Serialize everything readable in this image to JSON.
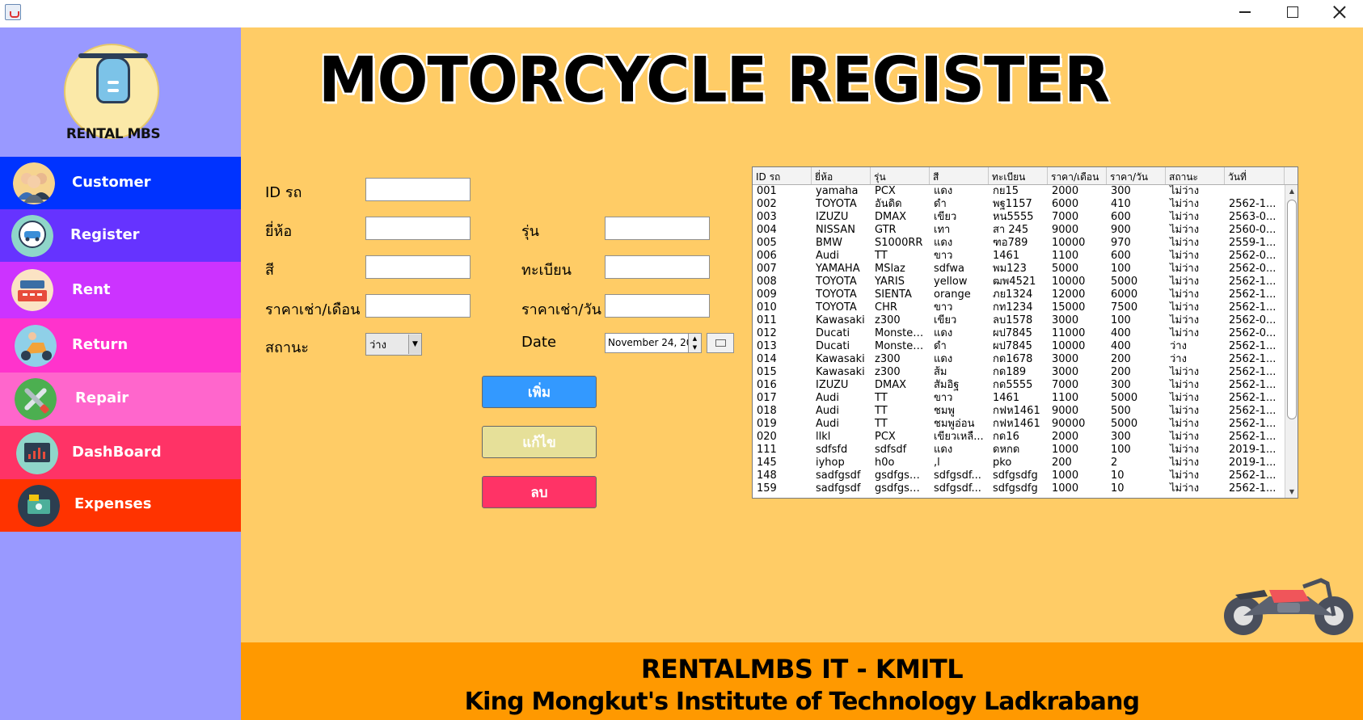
{
  "app": {
    "logo_text": "RENTAL MBS",
    "page_title": "MOTORCYCLE REGISTER"
  },
  "sidebar": {
    "items": [
      {
        "label": "Customer"
      },
      {
        "label": "Register"
      },
      {
        "label": "Rent"
      },
      {
        "label": "Return"
      },
      {
        "label": "Repair"
      },
      {
        "label": "DashBoard"
      },
      {
        "label": "Expenses"
      }
    ]
  },
  "form": {
    "id_label": "ID รถ",
    "brand_label": "ยี่ห้อ",
    "model_label": "รุ่น",
    "color_label": "สี",
    "plate_label": "ทะเบียน",
    "monthly_label": "ราคาเช่า/เดือน",
    "daily_label": "ราคาเช่า/วัน",
    "status_label": "สถานะ",
    "status_value": "ว่าง",
    "date_label": "Date",
    "date_value": "November 24, 20"
  },
  "buttons": {
    "add": "เพิ่ม",
    "edit": "แก้ไข",
    "delete": "ลบ"
  },
  "table": {
    "headers": [
      "ID รถ",
      "ยี่ห้อ",
      "รุ่น",
      "สี",
      "ทะเบียน",
      "ราคา/เดือน",
      "ราคา/วัน",
      "สถานะ",
      "วันที่"
    ],
    "rows": [
      [
        "001",
        "yamaha",
        "PCX",
        "แดง",
        "กย15",
        "2000",
        "300",
        "ไม่ว่าง",
        ""
      ],
      [
        "002",
        "TOYOTA",
        "อันดิด",
        "ดำ",
        "พฐ1157",
        "6000",
        "410",
        "ไม่ว่าง",
        "2562-1..."
      ],
      [
        "003",
        "IZUZU",
        "DMAX",
        "เขียว",
        "หน5555",
        "7000",
        "600",
        "ไม่ว่าง",
        "2563-0..."
      ],
      [
        "004",
        "NISSAN",
        "GTR",
        "เทา",
        "สา 245",
        "9000",
        "900",
        "ไม่ว่าง",
        "2560-0..."
      ],
      [
        "005",
        "BMW",
        "S1000RR",
        "แดง",
        "ฑอ789",
        "10000",
        "970",
        "ไม่ว่าง",
        "2559-1..."
      ],
      [
        "006",
        "Audi",
        "TT",
        "ขาว",
        "1461",
        "1100",
        "600",
        "ไม่ว่าง",
        "2562-0..."
      ],
      [
        "007",
        "YAMAHA",
        "MSlaz",
        "sdfwa",
        "พม123",
        "5000",
        "100",
        "ไม่ว่าง",
        "2562-0..."
      ],
      [
        "008",
        "TOYOTA",
        "YARIS",
        "yellow",
        "ฒพ4521",
        "10000",
        "5000",
        "ไม่ว่าง",
        "2562-1..."
      ],
      [
        "009",
        "TOYOTA",
        "SIENTA",
        "orange",
        "ภย1324",
        "12000",
        "6000",
        "ไม่ว่าง",
        "2562-1..."
      ],
      [
        "010",
        "TOYOTA",
        "CHR",
        "ขาว",
        "กท1234",
        "15000",
        "7500",
        "ไม่ว่าง",
        "2562-1..."
      ],
      [
        "011",
        "Kawasaki",
        "z300",
        "เขียว",
        "ลบ1578",
        "3000",
        "100",
        "ไม่ว่าง",
        "2562-0..."
      ],
      [
        "012",
        "Ducati",
        "Monster...",
        "แดง",
        "ผป7845",
        "11000",
        "400",
        "ไม่ว่าง",
        "2562-0..."
      ],
      [
        "013",
        "Ducati",
        "Monster...",
        "ดำ",
        "ผป7845",
        "10000",
        "400",
        "ว่าง",
        "2562-1..."
      ],
      [
        "014",
        "Kawasaki",
        "z300",
        "แดง",
        "กด1678",
        "3000",
        "200",
        "ว่าง",
        "2562-1..."
      ],
      [
        "015",
        "Kawasaki",
        "z300",
        "ส้ม",
        "กด189",
        "3000",
        "200",
        "ไม่ว่าง",
        "2562-1..."
      ],
      [
        "016",
        "IZUZU",
        "DMAX",
        "สัมอิฐ",
        "กด5555",
        "7000",
        "300",
        "ไม่ว่าง",
        "2562-1..."
      ],
      [
        "017",
        "Audi",
        "TT",
        "ขาว",
        "1461",
        "1100",
        "5000",
        "ไม่ว่าง",
        "2562-1..."
      ],
      [
        "018",
        "Audi",
        "TT",
        "ชมพู",
        "กฟห1461",
        "9000",
        "500",
        "ไม่ว่าง",
        "2562-1..."
      ],
      [
        "019",
        "Audi",
        "TT",
        "ชมพูอ่อน",
        "กฟห1461",
        "90000",
        "5000",
        "ไม่ว่าง",
        "2562-1..."
      ],
      [
        "020",
        "llkl",
        "PCX",
        "เขียวเหลื...",
        "กด16",
        "2000",
        "300",
        "ไม่ว่าง",
        "2562-1..."
      ],
      [
        "111",
        "sdfsfd",
        "sdfsdf",
        "แดง",
        "ดหกด",
        "1000",
        "100",
        "ไม่ว่าง",
        "2019-1..."
      ],
      [
        "145",
        "iyhop",
        "h0o",
        ",l",
        "pko",
        "200",
        "2",
        "ไม่ว่าง",
        "2019-1..."
      ],
      [
        "148",
        "sadfgsdf",
        "gsdfgsdfg",
        "sdfgsdf...",
        "sdfgsdfg",
        "1000",
        "10",
        "ไม่ว่าง",
        "2562-1..."
      ],
      [
        "159",
        "sadfgsdf",
        "gsdfgsdfg",
        "sdfgsdf...",
        "sdfgsdfg",
        "1000",
        "10",
        "ไม่ว่าง",
        "2562-1..."
      ]
    ]
  },
  "footer": {
    "title": "RENTALMBS IT - KMITL",
    "subtitle": "King Mongkut's Institute of  Technology Ladkrabang"
  },
  "icons": {
    "customer": "people-icon",
    "register": "car-pin-icon",
    "rent": "cash-register-icon",
    "return": "scooter-icon",
    "repair": "tools-icon",
    "dashboard": "chart-icon",
    "expenses": "money-icon"
  },
  "colors": {
    "sidebar_bg": "#9999ff",
    "main_bg": "#ffcc66",
    "footer_bg": "#ff9900",
    "customer": "#0033ff",
    "register": "#6633ff",
    "rent": "#cc33ff",
    "return": "#ff33cc",
    "repair": "#ff66cc",
    "dashboard": "#ff3366",
    "expenses": "#ff3300"
  }
}
